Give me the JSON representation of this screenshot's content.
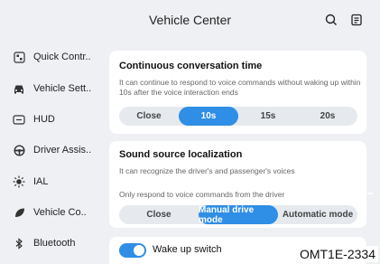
{
  "header": {
    "title": "Vehicle Center",
    "search_icon": "search-icon",
    "doc_icon": "document-icon"
  },
  "sidebar": {
    "items": [
      {
        "label": "Quick Contr..",
        "icon": "quick-control-icon"
      },
      {
        "label": "Vehicle Sett..",
        "icon": "car-icon"
      },
      {
        "label": "HUD",
        "icon": "hud-icon"
      },
      {
        "label": "Driver Assis..",
        "icon": "steering-wheel-icon"
      },
      {
        "label": "IAL",
        "icon": "light-icon"
      },
      {
        "label": "Vehicle Co..",
        "icon": "leaf-icon"
      },
      {
        "label": "Bluetooth",
        "icon": "bluetooth-icon"
      }
    ]
  },
  "conversation": {
    "title": "Continuous conversation time",
    "description": "It can continue to respond to voice commands without waking up within 10s after the voice interaction ends",
    "options": [
      "Close",
      "10s",
      "15s",
      "20s"
    ],
    "selected": "10s"
  },
  "localization": {
    "title": "Sound source localization",
    "description": "It can recognize the driver's and passenger's voices",
    "sub_description": "Only respond to voice commands from the driver",
    "options": [
      "Close",
      "Manual drive mode",
      "Automatic mode"
    ],
    "selected": "Manual drive mode"
  },
  "wakeup": {
    "label": "Wake up switch",
    "enabled": true
  },
  "watermark": "OMT1E-2334",
  "colors": {
    "accent": "#2f8ee5",
    "background": "#eef0f3",
    "card": "#ffffff"
  }
}
